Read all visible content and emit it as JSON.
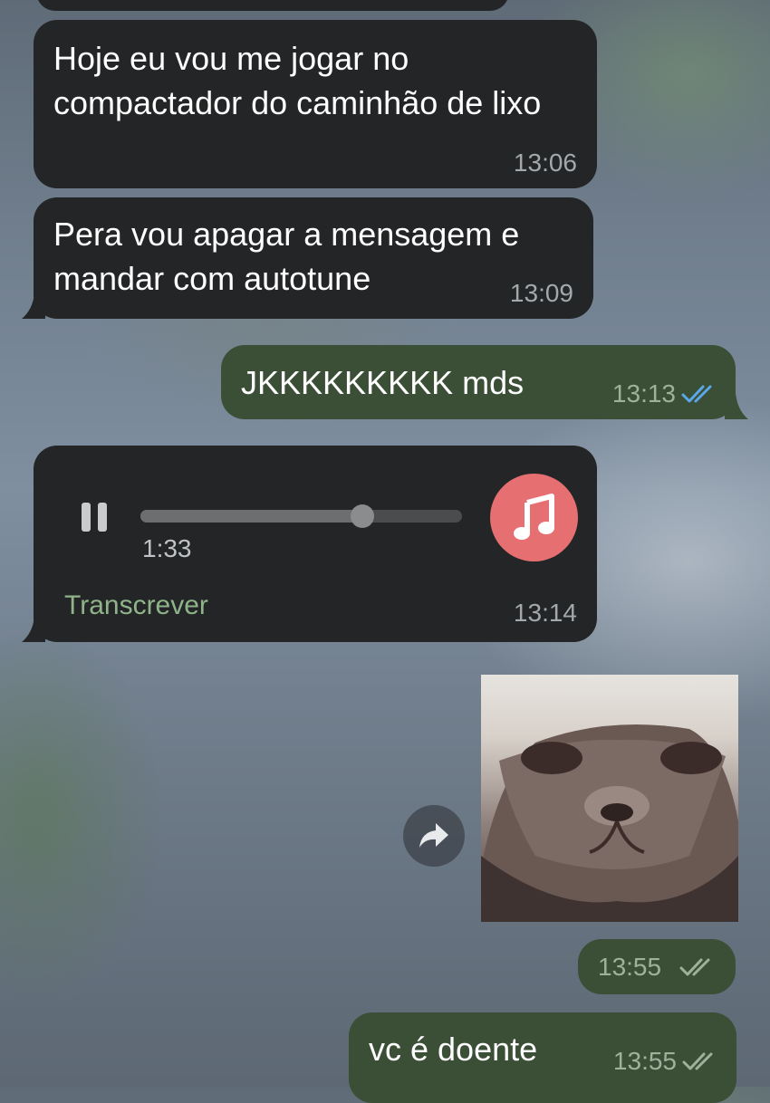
{
  "colors": {
    "incoming_bubble": "#232526",
    "outgoing_bubble": "#3b4f37",
    "read_tick": "#5aa8e8",
    "delivered_tick": "#9fb09c",
    "transcribe_link": "#8fb48a",
    "music_badge": "#e66f72"
  },
  "messages": [
    {
      "direction": "incoming",
      "text": "Hoje eu vou me jogar no compactador do caminhão de lixo",
      "time": "13:06"
    },
    {
      "direction": "incoming",
      "text": "Pera vou apagar a mensagem e mandar com autotune",
      "time": "13:09"
    },
    {
      "direction": "outgoing",
      "text": "JKKKKKKKKK mds",
      "time": "13:13",
      "status": "read"
    },
    {
      "direction": "incoming",
      "type": "audio",
      "duration": "1:33",
      "progress": 0.69,
      "control_icon": "pause-icon",
      "badge_icon": "music-note-icon",
      "transcribe_label": "Transcrever",
      "time": "13:14"
    },
    {
      "direction": "outgoing",
      "type": "image",
      "image_description": "cat-face-photo",
      "forward_icon": "forward-arrow-icon",
      "time": "13:55",
      "status": "delivered"
    },
    {
      "direction": "outgoing",
      "text": "vc é doente",
      "time": "13:55",
      "status": "delivered"
    }
  ]
}
